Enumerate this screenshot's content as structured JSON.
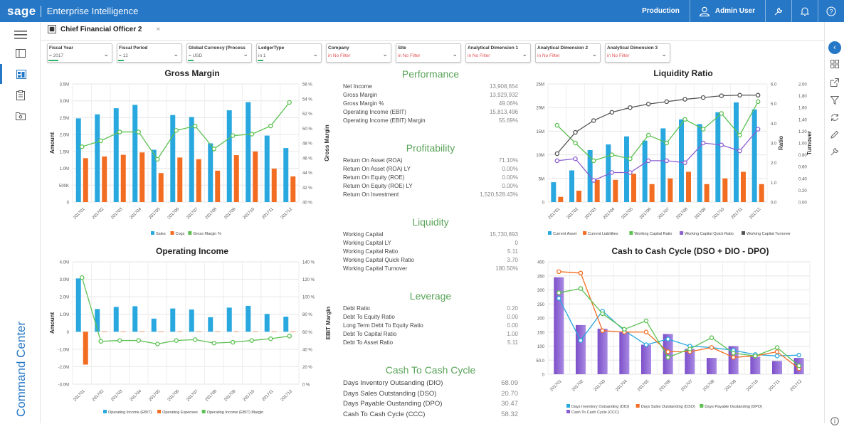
{
  "topbar": {
    "brand": "sage",
    "app_name": "Enterprise Intelligence",
    "environment": "Production",
    "user": "Admin User"
  },
  "nav": {
    "command_center": "Command Center"
  },
  "tab": {
    "label": "Chief Financial Officer 2",
    "close": "×"
  },
  "filters": [
    {
      "label": "Fiscal Year",
      "value": "= 2017",
      "set": true
    },
    {
      "label": "Fiscal Period",
      "value": "= 12",
      "set": true
    },
    {
      "label": "Global Currency (Process P...",
      "value": "= USD",
      "set": true
    },
    {
      "label": "LedgerType",
      "value": "in 1",
      "set": true
    },
    {
      "label": "Company",
      "value": "in No Filter",
      "set": false
    },
    {
      "label": "Site",
      "value": "in No Filter",
      "set": false
    },
    {
      "label": "Analytical Dimension 1",
      "value": "in No Filter",
      "set": false
    },
    {
      "label": "Analytical Dimension 2",
      "value": "in No Filter",
      "set": false
    },
    {
      "label": "Analytical Dimension 3",
      "value": "in No Filter",
      "set": false
    }
  ],
  "kpis": {
    "performance": {
      "title": "Performance",
      "rows": [
        {
          "label": "Net Income",
          "value": "13,908,654"
        },
        {
          "label": "Gross Margin",
          "value": "13,929,932"
        },
        {
          "label": "Gross Margin %",
          "value": "49.06%"
        },
        {
          "label": "Operating Income (EBIT)",
          "value": "15,813,496"
        },
        {
          "label": "Operating Income (EBIT) Margin",
          "value": "55.69%"
        }
      ]
    },
    "profitability": {
      "title": "Profitability",
      "rows": [
        {
          "label": "Return On Asset (ROA)",
          "value": "71.10%"
        },
        {
          "label": "Return On Asset (ROA) LY",
          "value": "0.00%"
        },
        {
          "label": "Return On Equity (ROE)",
          "value": "0.00%"
        },
        {
          "label": "Return On Equity (ROE) LY",
          "value": "0.00%"
        },
        {
          "label": "Return On Investment",
          "value": "1,520,528.43%"
        }
      ]
    },
    "liquidity": {
      "title": "Liquidity",
      "rows": [
        {
          "label": "Working Capital",
          "value": "15,730,893"
        },
        {
          "label": "Working Capital LY",
          "value": "0"
        },
        {
          "label": "Working Capital Ratio",
          "value": "5.11"
        },
        {
          "label": "Working Capital Quick Ratio",
          "value": "3.70"
        },
        {
          "label": "Working Capital Turnover",
          "value": "180.50%"
        }
      ]
    },
    "leverage": {
      "title": "Leverage",
      "rows": [
        {
          "label": "Debt Ratio",
          "value": "0.20"
        },
        {
          "label": "Debt To Equity Ratio",
          "value": "0.00"
        },
        {
          "label": "Long Term Debt To Equity Ratio",
          "value": "0.00"
        },
        {
          "label": "Debt To Capital Ratio",
          "value": "1.00"
        },
        {
          "label": "Debt To Asset Ratio",
          "value": "5.11"
        }
      ]
    },
    "cash": {
      "title": "Cash To Cash Cycle",
      "rows": [
        {
          "label": "Days Inventory Outsanding (DIO)",
          "value": "68.09"
        },
        {
          "label": "Days Sales Outstanding (DSO)",
          "value": "20.70"
        },
        {
          "label": "Days Payable Oustanding (DPO)",
          "value": "30.47"
        },
        {
          "label": "Cash To Cash Cycle (CCC)",
          "value": "58.32"
        }
      ]
    }
  },
  "colors": {
    "blue": "#29a8e0",
    "orange": "#f26d21",
    "green": "#5cc152",
    "purple": "#8b5fd1",
    "gray": "#555555",
    "accent": "#2677c6"
  },
  "chart_data": [
    {
      "id": "gross-margin",
      "type": "bar",
      "title": "Gross Margin",
      "ylabel": "Amount",
      "y2label": "Gross Margin",
      "categories": [
        "201701",
        "201702",
        "201703",
        "201704",
        "201705",
        "201706",
        "201707",
        "201708",
        "201709",
        "201710",
        "201711",
        "201712"
      ],
      "ylim": [
        0,
        3500000
      ],
      "yticks": [
        "0",
        "500K",
        "1.0M",
        "1.5M",
        "2.0M",
        "2.5M",
        "3.0M",
        "3.5M"
      ],
      "y2lim": [
        40,
        56
      ],
      "y2ticks": [
        "40 %",
        "42 %",
        "44 %",
        "46 %",
        "48 %",
        "50 %",
        "52 %",
        "54 %",
        "56 %"
      ],
      "series": [
        {
          "name": "Sales",
          "kind": "bar",
          "axis": "y",
          "values": [
            2480000,
            2600000,
            2780000,
            2880000,
            1550000,
            2580000,
            2520000,
            1740000,
            2720000,
            2960000,
            1970000,
            1600000
          ]
        },
        {
          "name": "Cogs",
          "kind": "bar",
          "axis": "y",
          "values": [
            1300000,
            1350000,
            1400000,
            1470000,
            860000,
            1320000,
            1270000,
            930000,
            1390000,
            1500000,
            990000,
            760000
          ]
        },
        {
          "name": "Gross Margin %",
          "kind": "line",
          "axis": "y2",
          "values": [
            47.5,
            48.3,
            49.5,
            49.5,
            45.8,
            49.7,
            50.3,
            47.2,
            49.0,
            49.2,
            50.3,
            53.5
          ]
        }
      ]
    },
    {
      "id": "operating-income",
      "type": "bar",
      "title": "Operating Income",
      "ylabel": "Amount",
      "y2label": "EBIT Margin",
      "categories": [
        "201701",
        "201702",
        "201703",
        "201704",
        "201705",
        "201706",
        "201707",
        "201708",
        "201709",
        "201710",
        "201711",
        "201712"
      ],
      "ylim": [
        -3000000,
        4000000
      ],
      "yticks": [
        "-3.0M",
        "-2.0M",
        "-1.0M",
        "0",
        "1.0M",
        "2.0M",
        "3.0M",
        "4.0M"
      ],
      "y2lim": [
        0,
        140
      ],
      "y2ticks": [
        "0 %",
        "20 %",
        "40 %",
        "60 %",
        "80 %",
        "100 %",
        "120 %",
        "140 %"
      ],
      "series": [
        {
          "name": "Operating Income (EBIT)",
          "kind": "bar",
          "axis": "y",
          "values": [
            3050000,
            1300000,
            1420000,
            1460000,
            750000,
            1330000,
            1270000,
            830000,
            1380000,
            1480000,
            1020000,
            860000
          ]
        },
        {
          "name": "Operating Expenses",
          "kind": "bar",
          "axis": "y",
          "values": [
            -1880000,
            20000,
            20000,
            20000,
            20000,
            20000,
            20000,
            20000,
            20000,
            20000,
            20000,
            20000
          ]
        },
        {
          "name": "Operating Income (EBIT) Margin",
          "kind": "line",
          "axis": "y2",
          "values": [
            122,
            49,
            50,
            50,
            46,
            50,
            51,
            47,
            48,
            50,
            52,
            55
          ]
        }
      ]
    },
    {
      "id": "liquidity-ratio",
      "type": "bar",
      "title": "Liquidity Ratio",
      "y2label": "Ratio",
      "y3label": "Turnover",
      "categories": [
        "201701",
        "201702",
        "201703",
        "201704",
        "201705",
        "201706",
        "201707",
        "201708",
        "201709",
        "201710",
        "201711",
        "201712"
      ],
      "ylim": [
        0,
        25000000
      ],
      "yticks": [
        "0",
        "5M",
        "10M",
        "15M",
        "20M",
        "25M"
      ],
      "y2lim": [
        0,
        6
      ],
      "y2ticks": [
        "0.0",
        "1.0",
        "2.0",
        "3.0",
        "4.0",
        "5.0",
        "6.0"
      ],
      "y3lim": [
        0,
        2
      ],
      "y3ticks": [
        "0.00",
        "0.20",
        "0.40",
        "0.60",
        "0.80",
        "1.00",
        "1.20",
        "1.40",
        "1.60",
        "1.80",
        "2.00"
      ],
      "series": [
        {
          "name": "Current Asset",
          "kind": "bar",
          "axis": "y",
          "values": [
            4200000,
            6700000,
            11000000,
            12200000,
            13900000,
            13000000,
            15600000,
            17500000,
            16500000,
            19000000,
            21100000,
            19600000
          ]
        },
        {
          "name": "Current Liabilities",
          "kind": "bar",
          "axis": "y",
          "values": [
            1100000,
            2400000,
            4700000,
            4700000,
            6000000,
            3800000,
            5000000,
            6400000,
            3800000,
            5000000,
            6400000,
            3800000
          ]
        },
        {
          "name": "Working Capital Ratio",
          "kind": "line",
          "axis": "y2",
          "values": [
            3.9,
            3.0,
            2.1,
            2.4,
            2.2,
            3.4,
            3.0,
            4.2,
            3.7,
            4.5,
            3.4,
            5.1
          ]
        },
        {
          "name": "Working Capital Quick Ratio",
          "kind": "line",
          "axis": "y2",
          "values": [
            2.1,
            2.2,
            1.1,
            1.5,
            1.5,
            2.1,
            2.1,
            2.0,
            3.0,
            2.9,
            2.6,
            3.7
          ]
        },
        {
          "name": "Working Capital Turnover",
          "kind": "line",
          "axis": "y3",
          "values": [
            0.82,
            1.18,
            1.38,
            1.52,
            1.6,
            1.66,
            1.7,
            1.74,
            1.77,
            1.8,
            1.81,
            1.81
          ]
        }
      ]
    },
    {
      "id": "cash-cycle",
      "type": "bar",
      "title": "Cash to Cash Cycle (DSO + DIO - DPO)",
      "categories": [
        "201701",
        "201702",
        "201703",
        "201704",
        "201705",
        "201706",
        "201707",
        "201708",
        "201709",
        "201710",
        "201711",
        "201712"
      ],
      "ylim": [
        0,
        400
      ],
      "yticks": [
        "0",
        "50.0",
        "100",
        "150",
        "200",
        "250",
        "300",
        "350",
        "400"
      ],
      "series": [
        {
          "name": "Days Inventory Outsanding (DIO)",
          "kind": "line",
          "values": [
            270,
            120,
            225,
            155,
            105,
            125,
            100,
            95,
            85,
            70,
            65,
            68
          ]
        },
        {
          "name": "Days Sales Outstanding (DSO)",
          "kind": "line",
          "values": [
            365,
            360,
            155,
            150,
            150,
            80,
            80,
            95,
            60,
            65,
            80,
            20
          ]
        },
        {
          "name": "Days Payable Oustanding (DPO)",
          "kind": "line",
          "values": [
            290,
            305,
            215,
            160,
            190,
            60,
            90,
            130,
            75,
            65,
            95,
            30
          ]
        },
        {
          "name": "Cash To Cash Cycle (CCC)",
          "kind": "bar",
          "values": [
            345,
            175,
            162,
            152,
            105,
            143,
            90,
            58,
            100,
            62,
            47,
            58
          ]
        }
      ]
    }
  ]
}
